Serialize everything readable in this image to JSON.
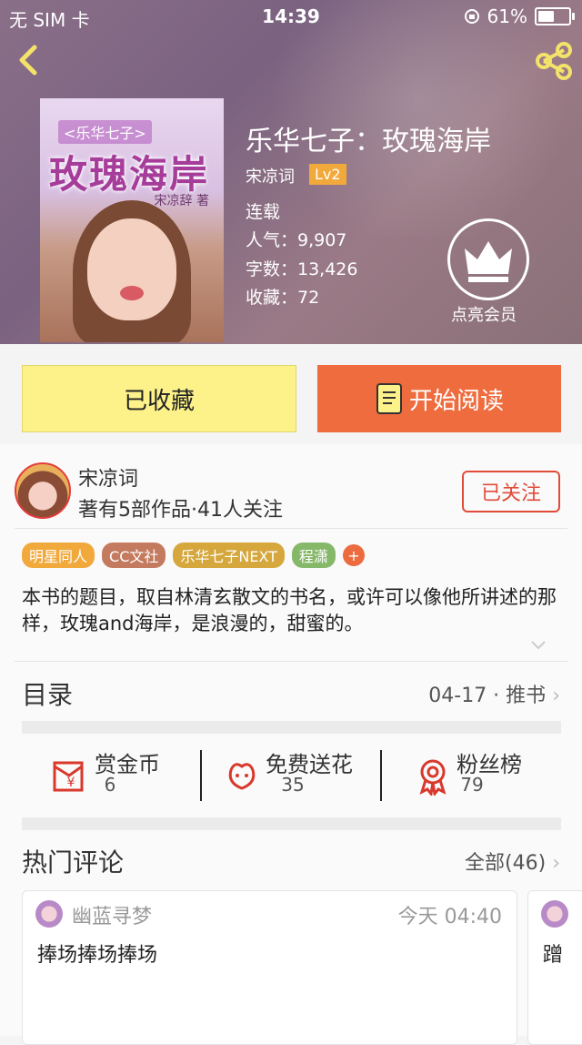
{
  "status_bar": {
    "carrier": "无 SIM 卡",
    "time": "14:39",
    "battery": "61%",
    "battery_level": 0.61
  },
  "book": {
    "cover_tag": "<乐华七子>",
    "cover_title": "玫瑰海岸",
    "cover_author": "宋凉辞 著",
    "title": "乐华七子：玫瑰海岸",
    "author": "宋凉词",
    "level": "Lv2",
    "status": "连载",
    "popularity": "人气：9,907",
    "word_count": "字数：13,426",
    "favorites": "收藏：72",
    "member_label": "点亮会员"
  },
  "actions": {
    "favorited_label": "已收藏",
    "read_label": "开始阅读"
  },
  "author": {
    "name": "宋凉词",
    "summary": "著有5部作品·41人关注",
    "follow_label": "已关注"
  },
  "tags": [
    {
      "label": "明星同人",
      "color": "#f2a93b"
    },
    {
      "label": "CC文社",
      "color": "#c47a5e"
    },
    {
      "label": "乐华七子NEXT",
      "color": "#d5a73c"
    },
    {
      "label": "程潇",
      "color": "#86b86a"
    }
  ],
  "tag_add": "+",
  "description": "本书的题目，取自林清玄散文的书名，或许可以像他所讲述的那样，玫瑰and海岸，是浪漫的，甜蜜的。",
  "toc": {
    "label": "目录",
    "latest": "04-17 · 推书"
  },
  "stats": [
    {
      "label": "赏金币",
      "value": "6",
      "icon": "coin-envelope-icon"
    },
    {
      "label": "免费送花",
      "value": "35",
      "icon": "flower-icon"
    },
    {
      "label": "粉丝榜",
      "value": "79",
      "icon": "medal-icon"
    }
  ],
  "comments": {
    "header": "热门评论",
    "all_label": "全部(46)",
    "items": [
      {
        "user": "幽蓝寻梦",
        "time": "今天 04:40",
        "text": "捧场捧场捧场"
      },
      {
        "user": "",
        "time": "",
        "text": "蹭"
      }
    ]
  },
  "colors": {
    "accent": "#ef6c3e",
    "favorite_bg": "#fdf28a",
    "follow": "#e04b3a"
  }
}
